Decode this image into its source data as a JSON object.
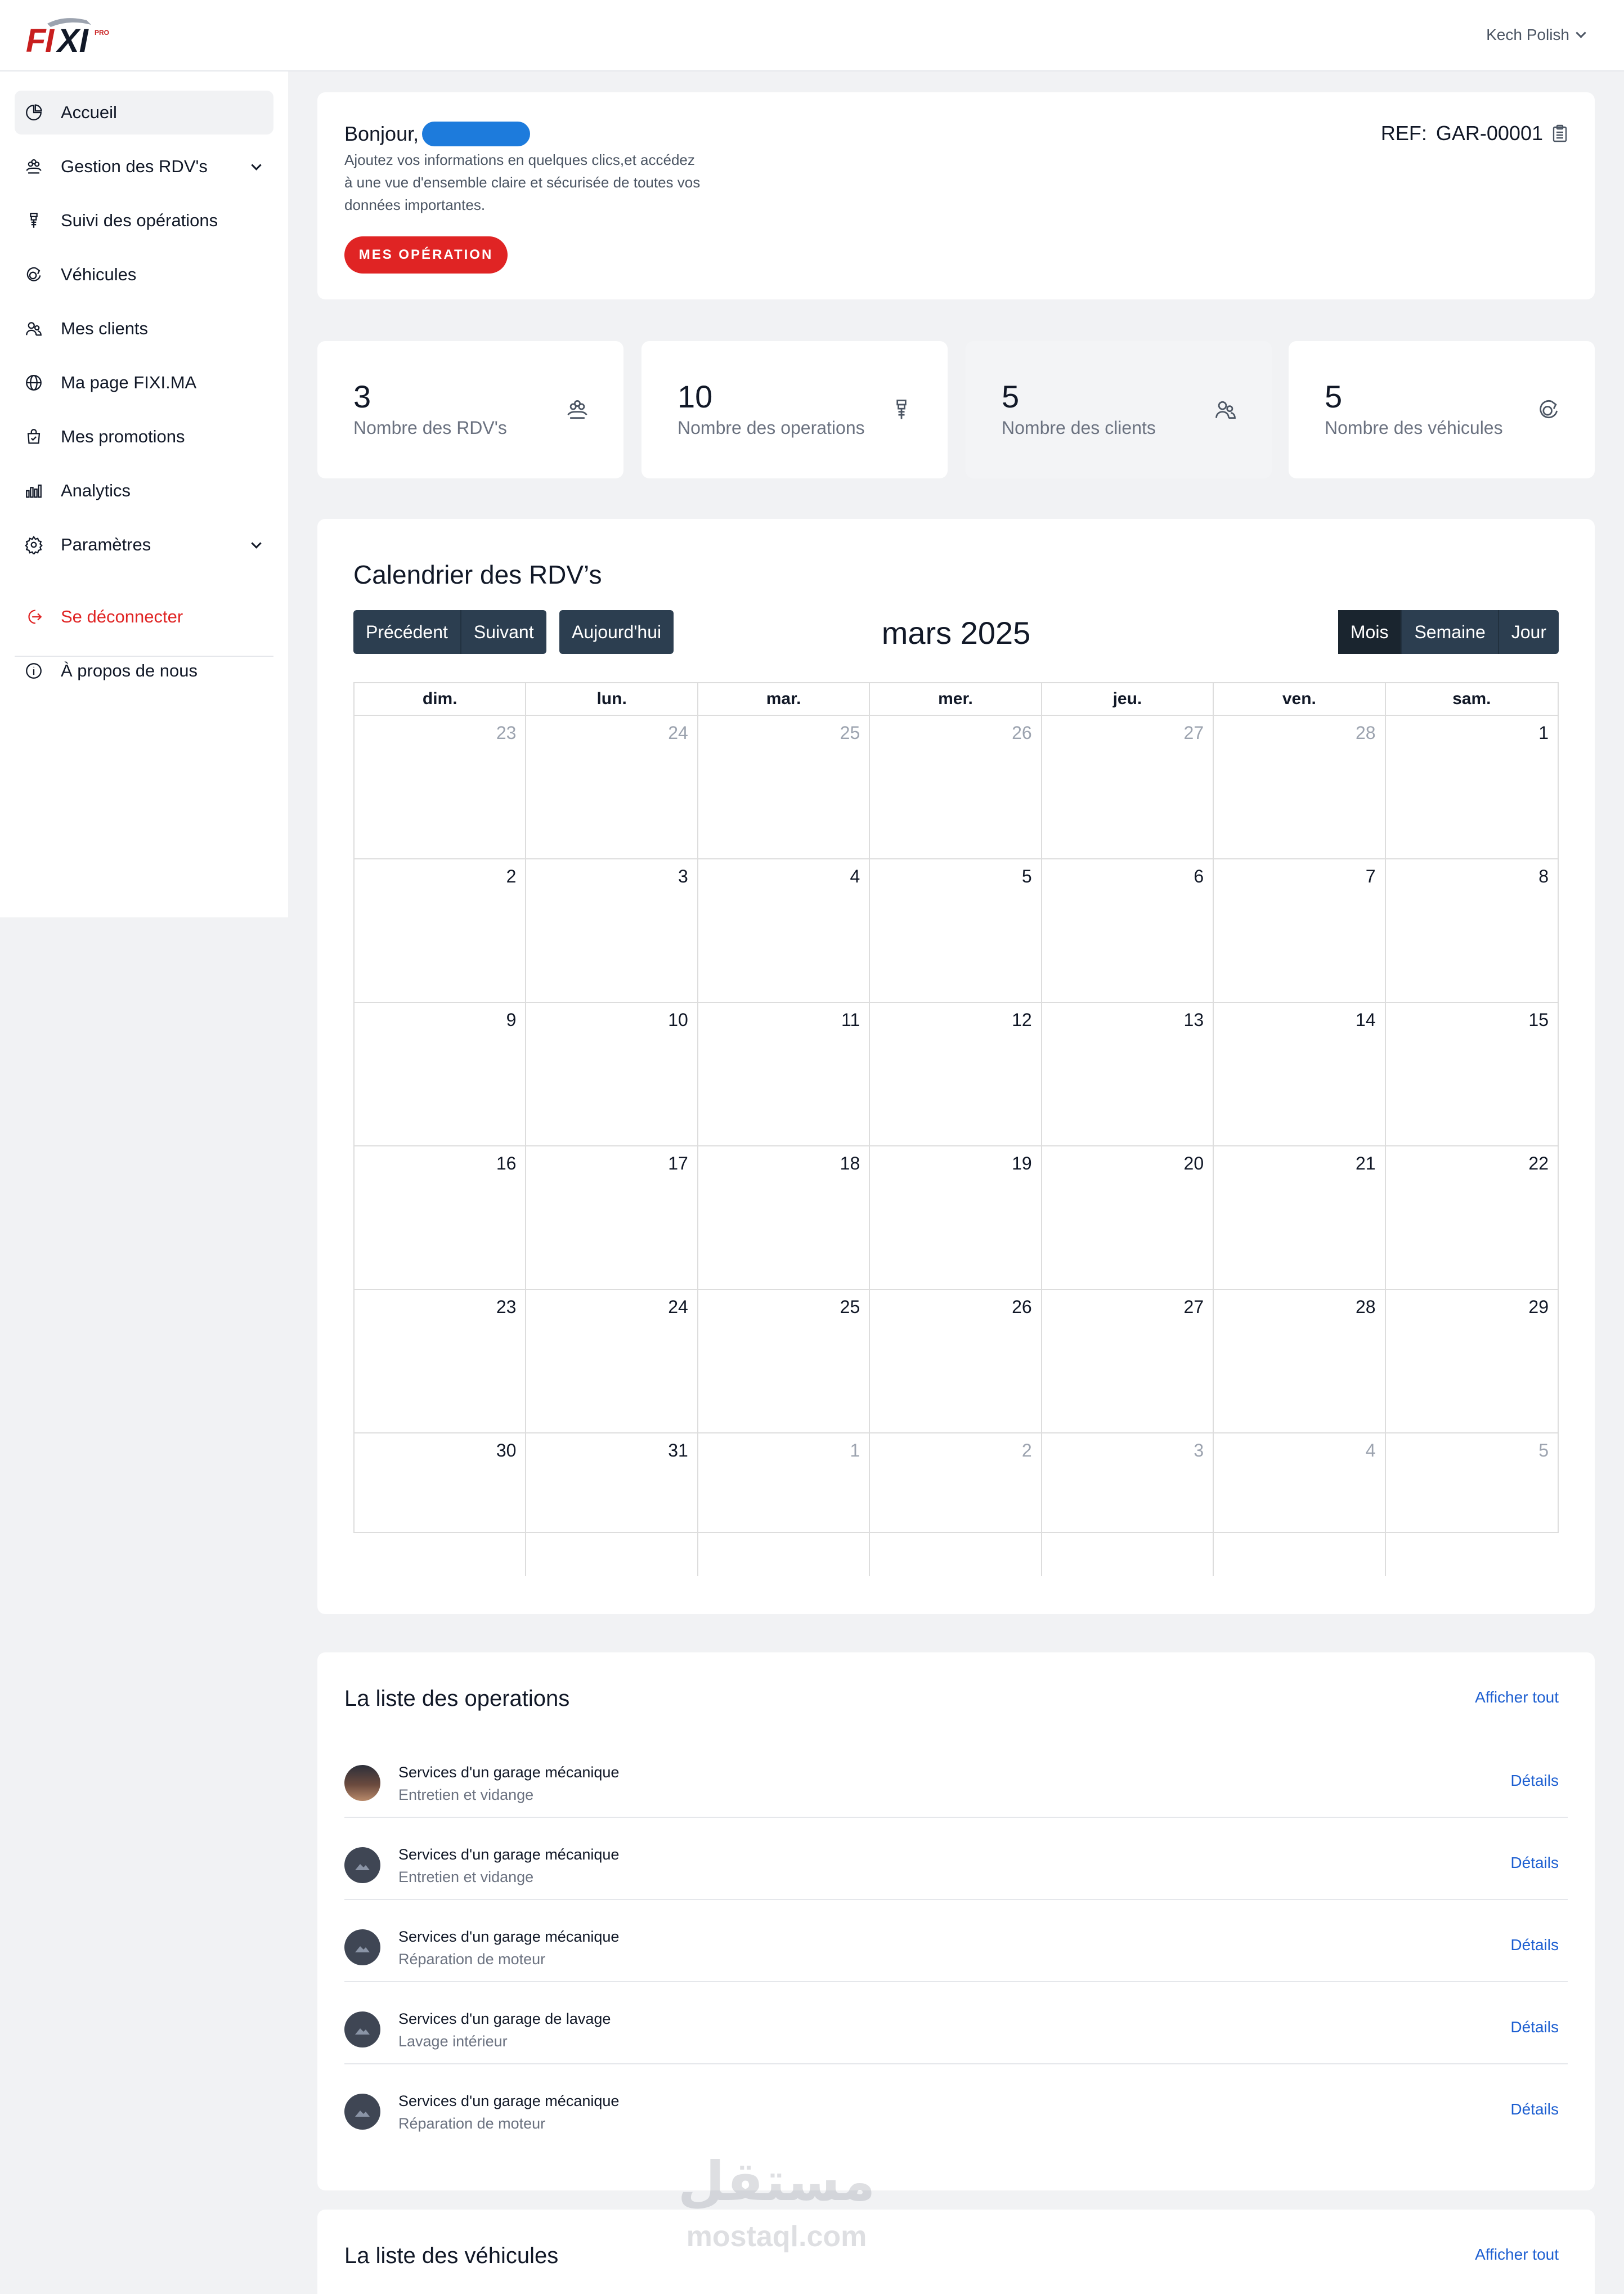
{
  "brand": {
    "logo_text": "FIXI",
    "logo_badge": "PRO",
    "colors": {
      "red": "#e02424",
      "blue": "#1d5fd1",
      "dark": "#2c3e50"
    }
  },
  "header": {
    "user_name": "Kech Polish"
  },
  "sidebar": {
    "items": [
      {
        "label": "Accueil",
        "icon": "dashboard-pie-icon",
        "active": true
      },
      {
        "label": "Gestion des RDV's",
        "icon": "appointments-icon",
        "has_caret": true
      },
      {
        "label": "Suivi des opérations",
        "icon": "operations-icon"
      },
      {
        "label": "Véhicules",
        "icon": "vehicle-icon"
      },
      {
        "label": "Mes clients",
        "icon": "clients-icon"
      },
      {
        "label": "Ma page FIXI.MA",
        "icon": "globe-icon"
      },
      {
        "label": "Mes promotions",
        "icon": "promotions-bag-icon"
      },
      {
        "label": "Analytics",
        "icon": "analytics-bars-icon"
      },
      {
        "label": "Paramètres",
        "icon": "settings-gear-icon",
        "has_caret": true
      }
    ],
    "logout": "Se déconnecter",
    "about": "À propos de nous"
  },
  "welcome": {
    "greeting": "Bonjour,",
    "description": "Ajoutez vos informations en quelques clics,et accédez à une vue d'ensemble claire et sécurisée de toutes vos données importantes.",
    "button": "MES OPÉRATION",
    "ref_label": "REF:",
    "ref_value": "GAR-00001"
  },
  "stats": [
    {
      "value": "3",
      "label": "Nombre des RDV's",
      "icon": "appointments-icon"
    },
    {
      "value": "10",
      "label": "Nombre des operations",
      "icon": "operations-icon"
    },
    {
      "value": "5",
      "label": "Nombre des clients",
      "icon": "clients-icon"
    },
    {
      "value": "5",
      "label": "Nombre des véhicules",
      "icon": "vehicle-icon"
    }
  ],
  "calendar": {
    "title": "Calendrier des RDV’s",
    "prev": "Précédent",
    "next": "Suivant",
    "today": "Aujourd'hui",
    "month_label": "mars 2025",
    "views": [
      "Mois",
      "Semaine",
      "Jour"
    ],
    "active_view": "Mois",
    "weekdays": [
      "dim.",
      "lun.",
      "mar.",
      "mer.",
      "jeu.",
      "ven.",
      "sam."
    ],
    "weeks": [
      [
        {
          "d": "23",
          "m": true
        },
        {
          "d": "24",
          "m": true
        },
        {
          "d": "25",
          "m": true
        },
        {
          "d": "26",
          "m": true
        },
        {
          "d": "27",
          "m": true
        },
        {
          "d": "28",
          "m": true
        },
        {
          "d": "1",
          "m": false
        }
      ],
      [
        {
          "d": "2",
          "m": false
        },
        {
          "d": "3",
          "m": false
        },
        {
          "d": "4",
          "m": false
        },
        {
          "d": "5",
          "m": false
        },
        {
          "d": "6",
          "m": false
        },
        {
          "d": "7",
          "m": false
        },
        {
          "d": "8",
          "m": false
        }
      ],
      [
        {
          "d": "9",
          "m": false
        },
        {
          "d": "10",
          "m": false
        },
        {
          "d": "11",
          "m": false
        },
        {
          "d": "12",
          "m": false
        },
        {
          "d": "13",
          "m": false
        },
        {
          "d": "14",
          "m": false
        },
        {
          "d": "15",
          "m": false
        }
      ],
      [
        {
          "d": "16",
          "m": false
        },
        {
          "d": "17",
          "m": false
        },
        {
          "d": "18",
          "m": false
        },
        {
          "d": "19",
          "m": false
        },
        {
          "d": "20",
          "m": false
        },
        {
          "d": "21",
          "m": false
        },
        {
          "d": "22",
          "m": false
        }
      ],
      [
        {
          "d": "23",
          "m": false
        },
        {
          "d": "24",
          "m": false
        },
        {
          "d": "25",
          "m": false
        },
        {
          "d": "26",
          "m": false
        },
        {
          "d": "27",
          "m": false
        },
        {
          "d": "28",
          "m": false
        },
        {
          "d": "29",
          "m": false
        }
      ],
      [
        {
          "d": "30",
          "m": false
        },
        {
          "d": "31",
          "m": false
        },
        {
          "d": "1",
          "m": true
        },
        {
          "d": "2",
          "m": true
        },
        {
          "d": "3",
          "m": true
        },
        {
          "d": "4",
          "m": true
        },
        {
          "d": "5",
          "m": true
        }
      ]
    ]
  },
  "operations": {
    "title": "La liste des operations",
    "show_all": "Afficher tout",
    "items": [
      {
        "title": "Services d'un garage mécanique",
        "subtitle": "Entretien et vidange",
        "link": "Détails",
        "avatar": "photo"
      },
      {
        "title": "Services d'un garage mécanique",
        "subtitle": "Entretien et vidange",
        "link": "Détails",
        "avatar": "placeholder-image-icon"
      },
      {
        "title": "Services d'un garage mécanique",
        "subtitle": "Réparation de moteur",
        "link": "Détails",
        "avatar": "placeholder-image-icon"
      },
      {
        "title": "Services d'un garage de lavage",
        "subtitle": "Lavage intérieur",
        "link": "Détails",
        "avatar": "placeholder-image-icon"
      },
      {
        "title": "Services d'un garage mécanique",
        "subtitle": "Réparation de moteur",
        "link": "Détails",
        "avatar": "placeholder-image-icon"
      }
    ]
  },
  "vehicles": {
    "title": "La liste des véhicules",
    "show_all": "Afficher tout"
  },
  "watermark": {
    "arabic": "مستقل",
    "latin": "mostaql.com"
  }
}
